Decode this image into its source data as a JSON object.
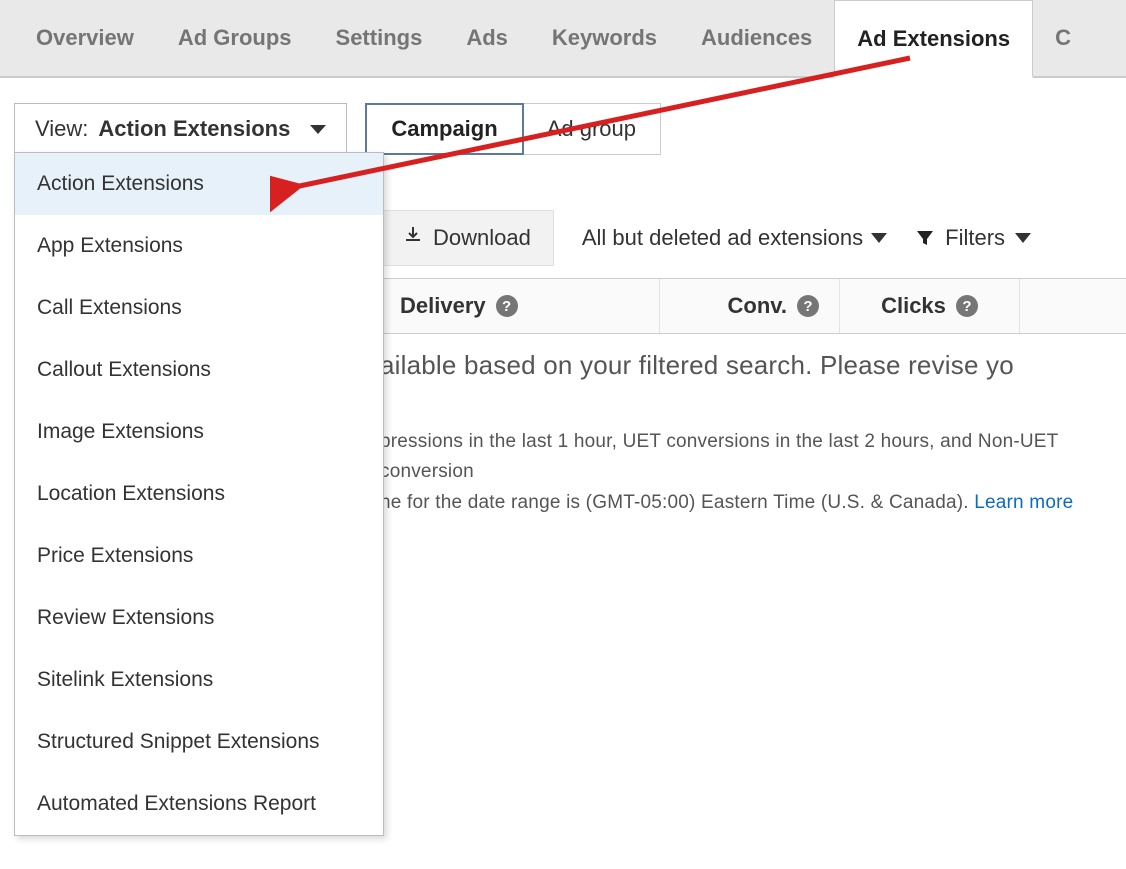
{
  "tabs": {
    "overview": "Overview",
    "adgroups": "Ad Groups",
    "settings": "Settings",
    "ads": "Ads",
    "keywords": "Keywords",
    "audiences": "Audiences",
    "adextensions": "Ad Extensions",
    "partial": "C"
  },
  "view": {
    "label": "View: ",
    "value": "Action Extensions"
  },
  "scope": {
    "campaign": "Campaign",
    "adgroup": "Ad group"
  },
  "dropdown": {
    "items": [
      "Action Extensions",
      "App Extensions",
      "Call Extensions",
      "Callout Extensions",
      "Image Extensions",
      "Location Extensions",
      "Price Extensions",
      "Review Extensions",
      "Sitelink Extensions",
      "Structured Snippet Extensions",
      "Automated Extensions Report"
    ]
  },
  "toolbar": {
    "download": "Download",
    "status_filter": "All but deleted ad extensions",
    "filters": "Filters"
  },
  "columns": {
    "delivery": "Delivery",
    "conv": "Conv.",
    "clicks": "Clicks"
  },
  "message": {
    "main": "ailable based on your filtered search. Please revise yo",
    "sub1": "pressions in the last 1 hour, UET conversions in the last 2 hours, and Non-UET conversion",
    "sub2": "ne for the date range is (GMT-05:00) Eastern Time (U.S. & Canada). ",
    "learn_more": "Learn more"
  }
}
